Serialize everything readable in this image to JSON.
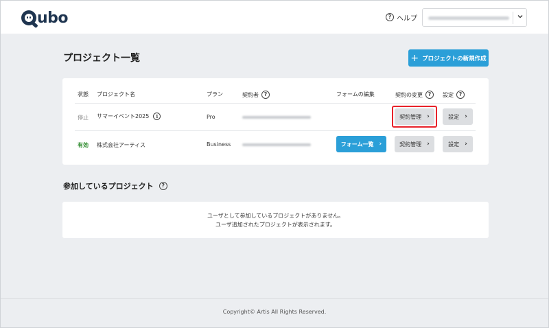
{
  "header": {
    "logo": "Qubo",
    "help_label": "ヘルプ",
    "account_chevron": "⌄"
  },
  "projects": {
    "title": "プロジェクト一覧",
    "new_button": "プロジェクトの新規作成",
    "columns": {
      "status": "状態",
      "name": "プロジェクト名",
      "plan": "プラン",
      "contractor": "契約者",
      "form_edit": "フォームの編集",
      "contract_change": "契約の変更",
      "settings": "設定"
    },
    "rows": [
      {
        "status": "停止",
        "name": "サマーイベント2025",
        "plan": "Pro",
        "form_button": "",
        "contract_button": "契約管理",
        "settings_button": "設定"
      },
      {
        "status": "有効",
        "name": "株式会社アーティス",
        "plan": "Business",
        "form_button": "フォーム一覧",
        "contract_button": "契約管理",
        "settings_button": "設定"
      }
    ]
  },
  "participating": {
    "title": "参加しているプロジェクト",
    "empty_line1": "ユーザとして参加しているプロジェクトがありません。",
    "empty_line2": "ユーザ追加されたプロジェクトが表示されます。"
  },
  "footer": {
    "copyright": "Copyright© Artis All Rights Reserved."
  },
  "colors": {
    "primary": "#2b9fd8",
    "highlight": "#e8222a",
    "active": "#2e8b2e"
  }
}
